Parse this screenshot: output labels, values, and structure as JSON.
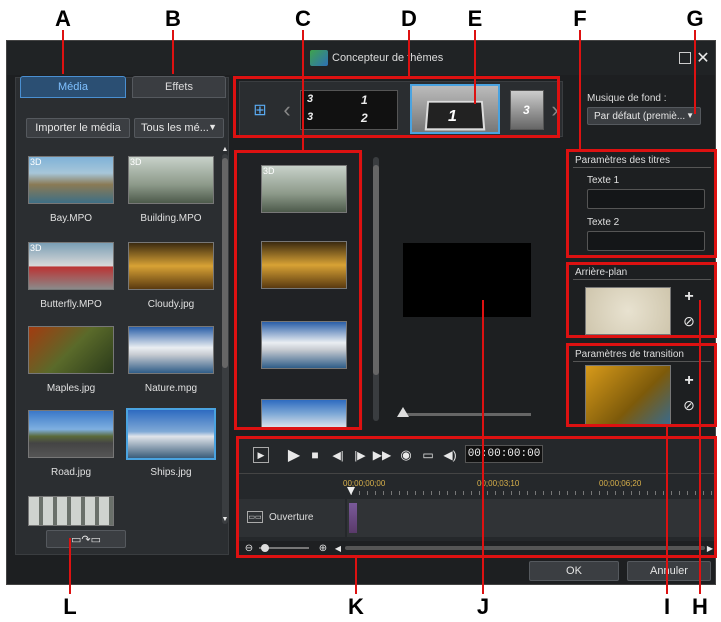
{
  "callouts": {
    "A": "A",
    "B": "B",
    "C": "C",
    "D": "D",
    "E": "E",
    "F": "F",
    "G": "G",
    "H": "H",
    "I": "I",
    "J": "J",
    "K": "K",
    "L": "L"
  },
  "window": {
    "title": "Concepteur de thèmes"
  },
  "tabs": {
    "media": "Média",
    "effects": "Effets"
  },
  "media_panel": {
    "import_label": "Importer le média",
    "filter_label": "Tous les mé...",
    "items": [
      {
        "name": "Bay.MPO",
        "badge": "3D"
      },
      {
        "name": "Building.MPO",
        "badge": "3D"
      },
      {
        "name": "Butterfly.MPO",
        "badge": "3D"
      },
      {
        "name": "Cloudy.jpg",
        "badge": ""
      },
      {
        "name": "Maples.jpg",
        "badge": ""
      },
      {
        "name": "Nature.mpg",
        "badge": ""
      },
      {
        "name": "Road.jpg",
        "badge": ""
      },
      {
        "name": "Ships.jpg",
        "badge": ""
      }
    ]
  },
  "slots": {
    "badge": "3D"
  },
  "template_strip": {
    "frame_numbers": [
      "1",
      "2",
      "3",
      "3",
      "1",
      "3"
    ]
  },
  "music": {
    "label": "Musique de fond :",
    "value": "Par défaut (premiè..."
  },
  "title_settings": {
    "title": "Paramètres des titres",
    "text1": "Texte 1",
    "text2": "Texte 2"
  },
  "background": {
    "title": "Arrière-plan"
  },
  "transition": {
    "title": "Paramètres de transition"
  },
  "timeline": {
    "timecode": "00:00:00:00",
    "ruler": [
      "00;00;00;00",
      "00;00;03;10",
      "00;00;06;20"
    ],
    "track_label": "Ouverture"
  },
  "buttons": {
    "ok": "OK",
    "cancel": "Annuler"
  },
  "colors": {
    "callout_red": "#d11",
    "accent_blue": "#4aa3e0"
  }
}
